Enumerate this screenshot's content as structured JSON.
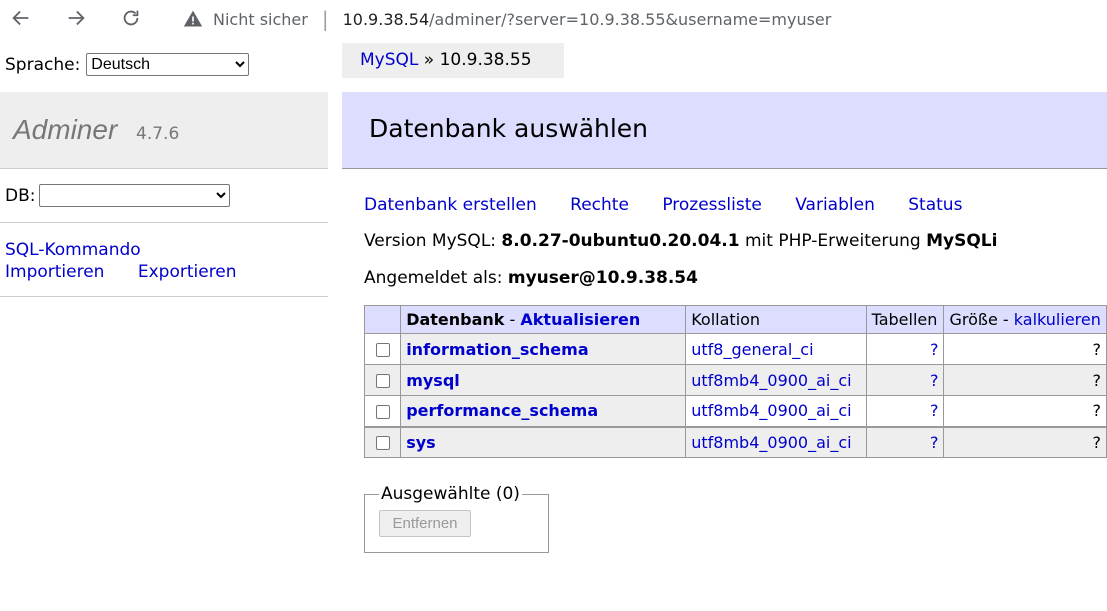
{
  "browser": {
    "security_label": "Nicht sicher",
    "url_host": "10.9.38.54",
    "url_path": "/adminer/?server=10.9.38.55&username=myuser"
  },
  "sidebar": {
    "language_label": "Sprache:",
    "language_value": "Deutsch",
    "app_name": "Adminer",
    "app_version": "4.7.6",
    "db_label": "DB:",
    "db_value": "",
    "sql_command": "SQL-Kommando",
    "import": "Importieren",
    "export": "Exportieren"
  },
  "breadcrumb": {
    "root": "MySQL",
    "separator": "»",
    "current": "10.9.38.55"
  },
  "page": {
    "title": "Datenbank auswählen",
    "links": [
      "Datenbank erstellen",
      "Rechte",
      "Prozessliste",
      "Variablen",
      "Status"
    ],
    "version_prefix": "Version MySQL:",
    "mysql_version": "8.0.27-0ubuntu0.20.04.1",
    "version_middle": "mit PHP-Erweiterung",
    "extension": "MySQLi",
    "logged_prefix": "Angemeldet als:",
    "logged_user": "myuser@10.9.38.54"
  },
  "table": {
    "col_database": "Datenbank",
    "col_dash": " - ",
    "col_refresh": "Aktualisieren",
    "col_collation": "Kollation",
    "col_tables": "Tabellen",
    "col_size": "Größe",
    "col_calc": "kalkulieren",
    "rows": [
      {
        "name": "information_schema",
        "collation": "utf8_general_ci",
        "tables": "?",
        "size": "?"
      },
      {
        "name": "mysql",
        "collation": "utf8mb4_0900_ai_ci",
        "tables": "?",
        "size": "?"
      },
      {
        "name": "performance_schema",
        "collation": "utf8mb4_0900_ai_ci",
        "tables": "?",
        "size": "?"
      },
      {
        "name": "sys",
        "collation": "utf8mb4_0900_ai_ci",
        "tables": "?",
        "size": "?"
      }
    ]
  },
  "selected": {
    "legend": "Ausgewählte (0)",
    "remove_button": "Entfernen"
  }
}
